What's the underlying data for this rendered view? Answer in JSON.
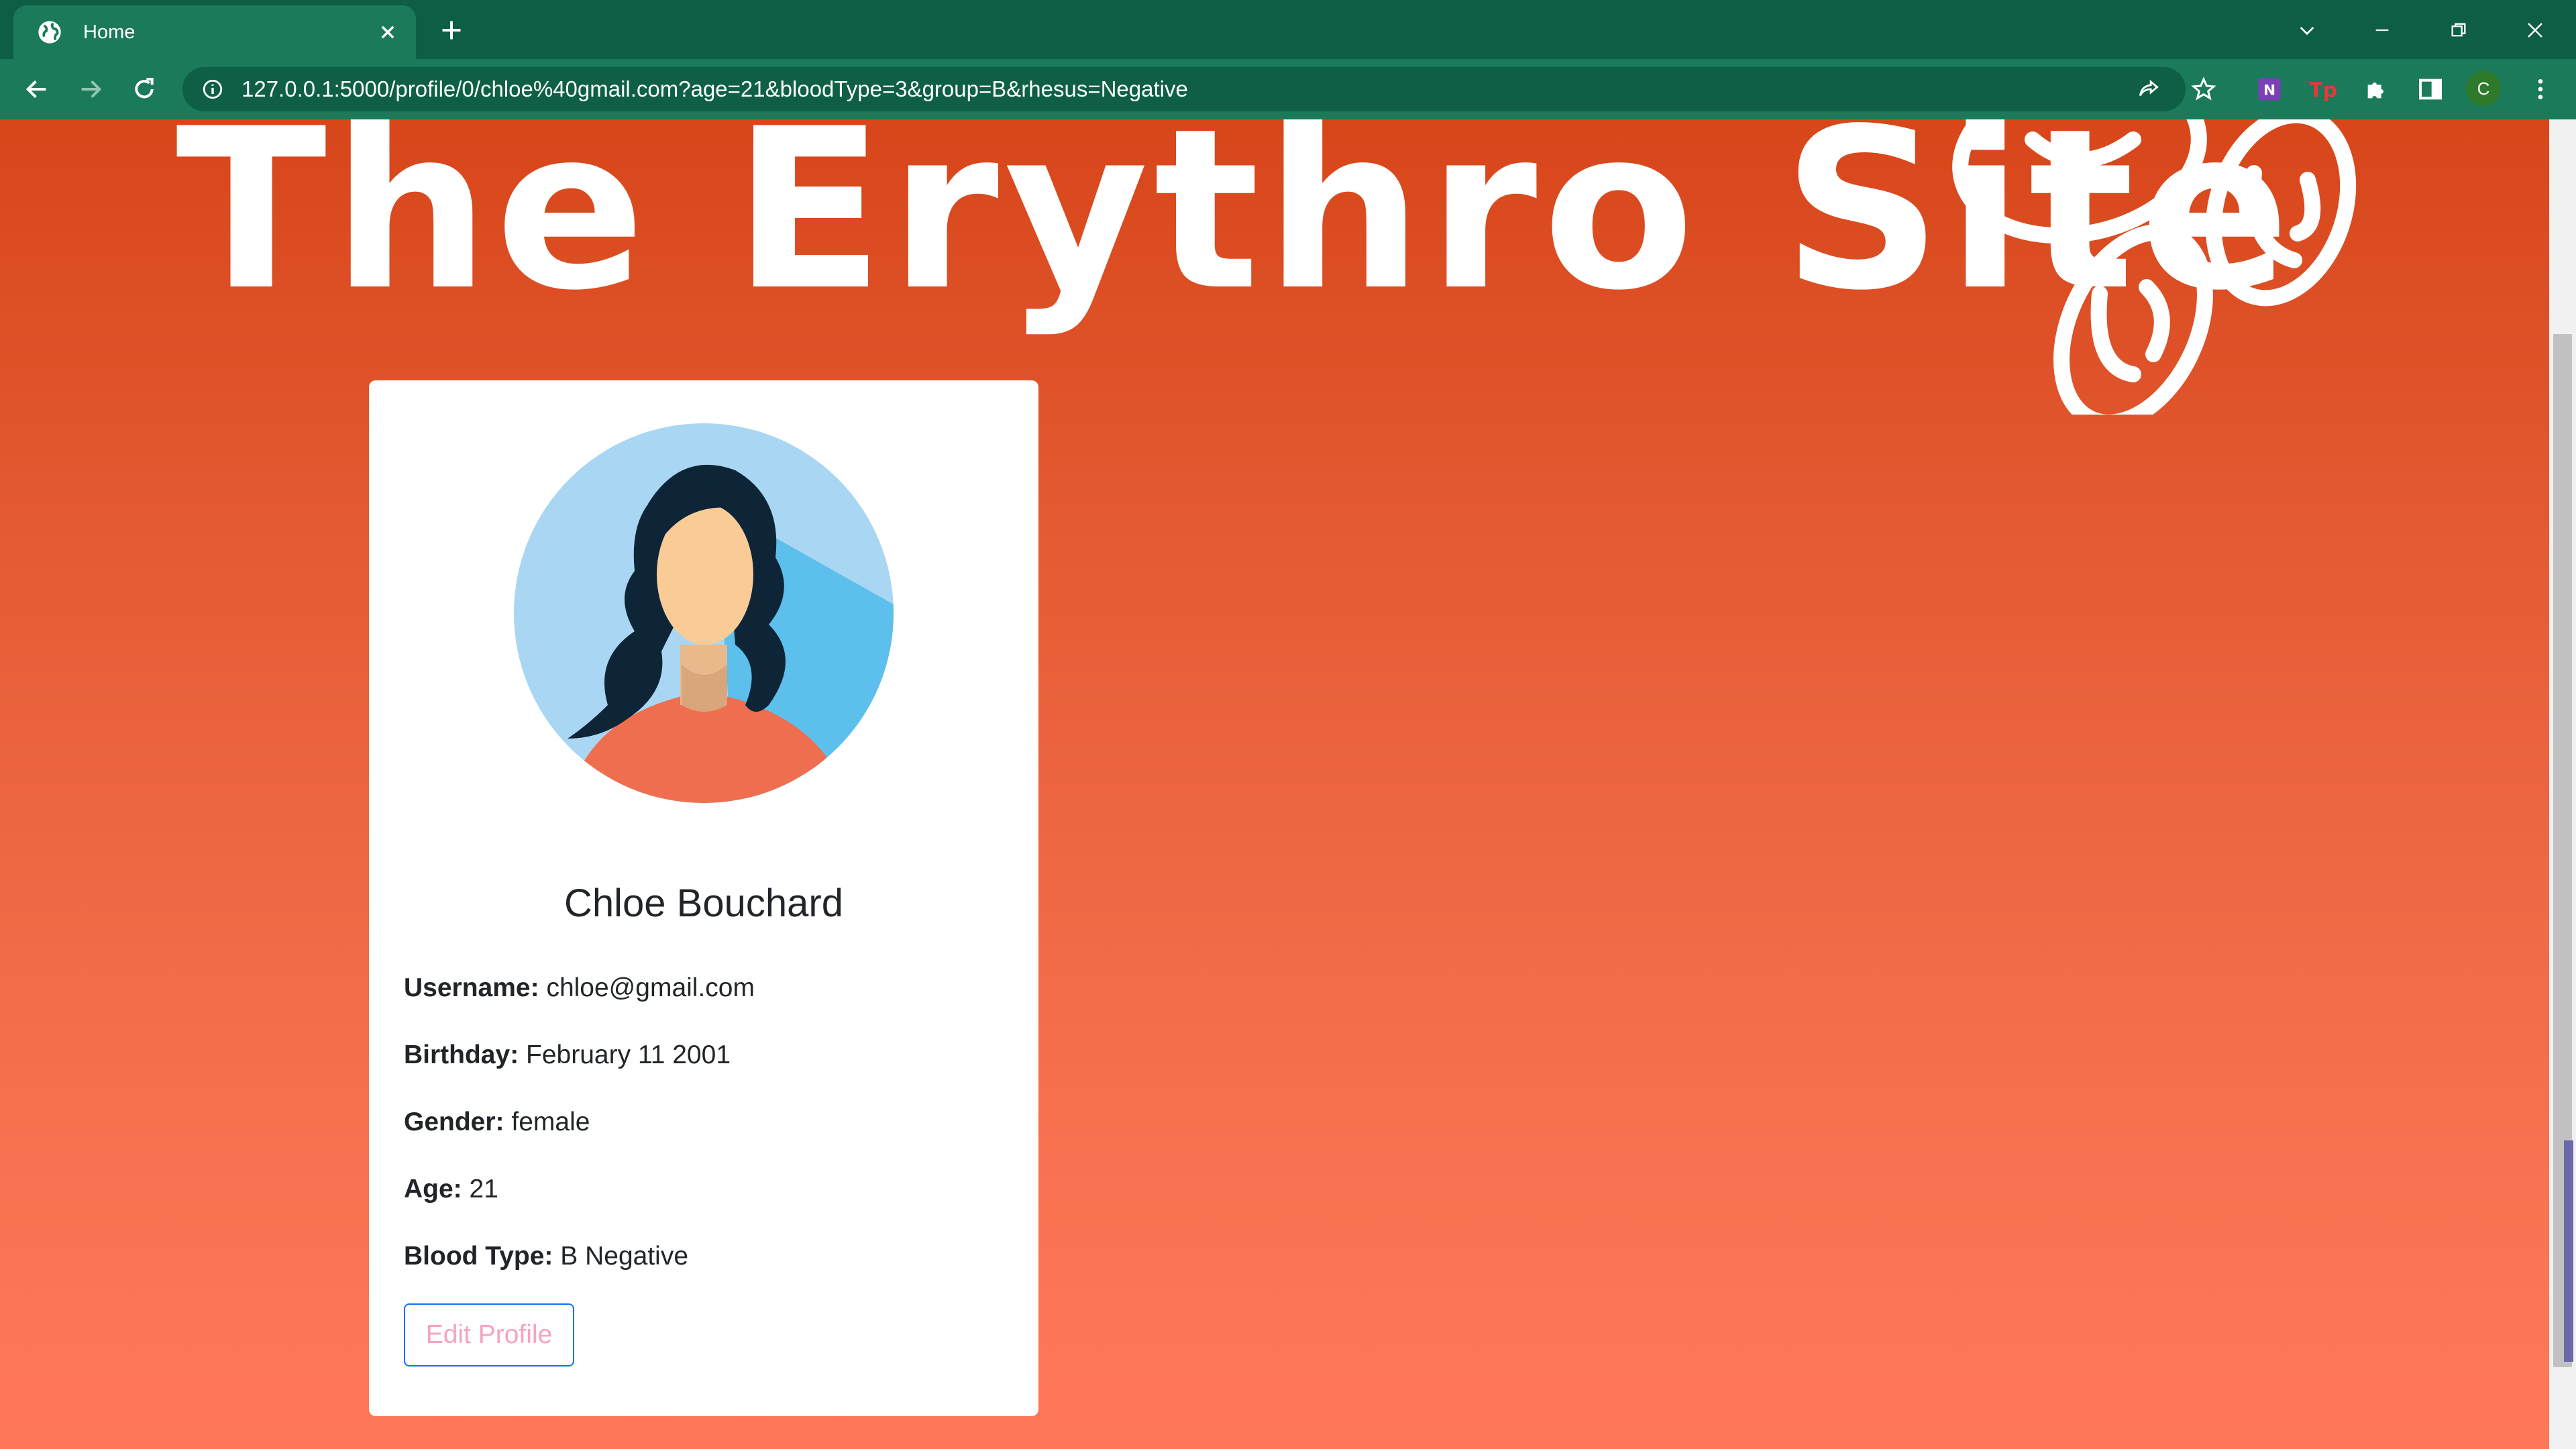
{
  "browser": {
    "tab_title": "Home",
    "url": "127.0.0.1:5000/profile/0/chloe%40gmail.com?age=21&bloodType=3&group=B&rhesus=Negative",
    "profile_initial": "C"
  },
  "site": {
    "title": "The Erythro Site"
  },
  "profile": {
    "name": "Chloe Bouchard",
    "fields": [
      {
        "label": "Username:",
        "value": "chloe@gmail.com"
      },
      {
        "label": "Birthday:",
        "value": "February 11 2001"
      },
      {
        "label": "Gender:",
        "value": "female"
      },
      {
        "label": "Age:",
        "value": "21"
      },
      {
        "label": "Blood Type:",
        "value": "B Negative"
      }
    ],
    "edit_button": "Edit Profile"
  },
  "colors": {
    "chrome_dark": "#0d5e44",
    "chrome_light": "#1a7a59",
    "page_top": "#d8461a",
    "page_bottom": "#ff7757",
    "edit_border": "#0d6efd",
    "edit_text": "#f7a3c0"
  }
}
